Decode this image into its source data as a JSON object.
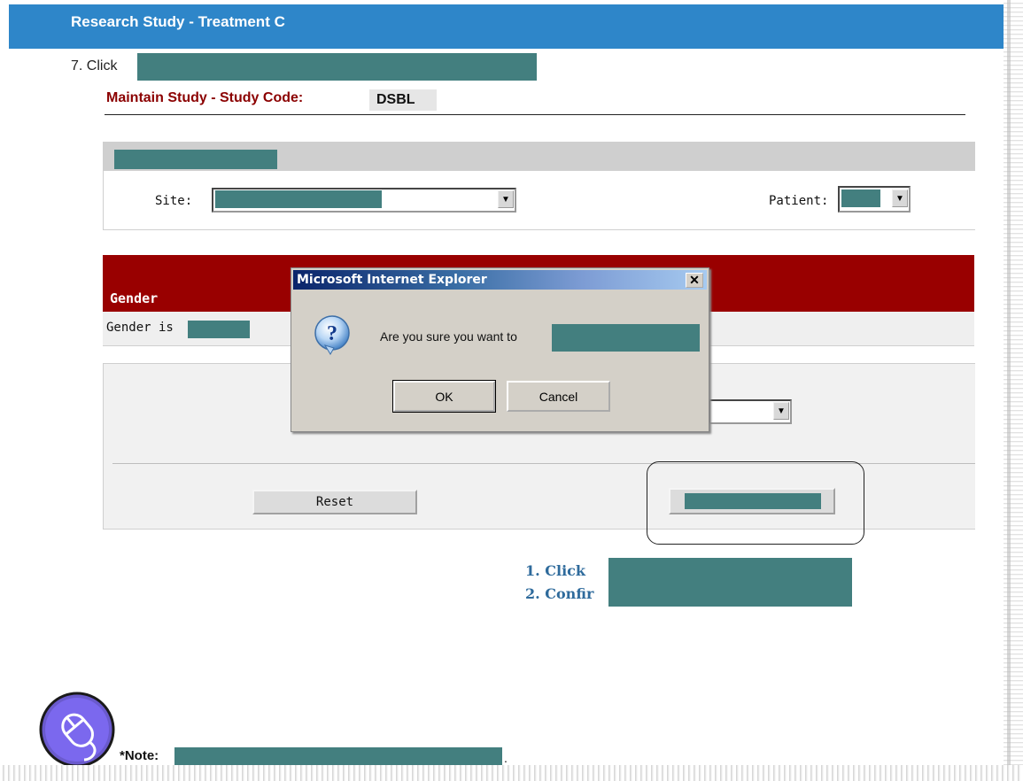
{
  "header": {
    "title": "Research Study - Treatment C"
  },
  "step": {
    "label": "7. Click"
  },
  "study": {
    "heading": "Maintain Study - Study Code:",
    "code": "DSBL"
  },
  "filters": {
    "site_label": "Site:",
    "patient_label": "Patient:"
  },
  "gender": {
    "section_title": "Gender",
    "row_label": "Gender is"
  },
  "form": {
    "reset_label": "Reset"
  },
  "dialog": {
    "title": "Microsoft Internet Explorer",
    "message": "Are you sure you want to",
    "ok_label": "OK",
    "cancel_label": "Cancel",
    "close_glyph": "✕"
  },
  "instructions": {
    "line1": "1.  Click",
    "line2": "2.  Confir"
  },
  "footer": {
    "note_label": "*Note:",
    "note_tail": "."
  },
  "colors": {
    "header_blue": "#2e86c9",
    "gender_red": "#990000",
    "redaction_teal": "#437f7f",
    "heading_maroon": "#8b0000",
    "instruction_blue": "#2f6b9c"
  },
  "icons": {
    "dialog_icon": "question-icon",
    "badge_icon": "mouse-icon",
    "dropdown_icon": "chevron-down-icon"
  }
}
